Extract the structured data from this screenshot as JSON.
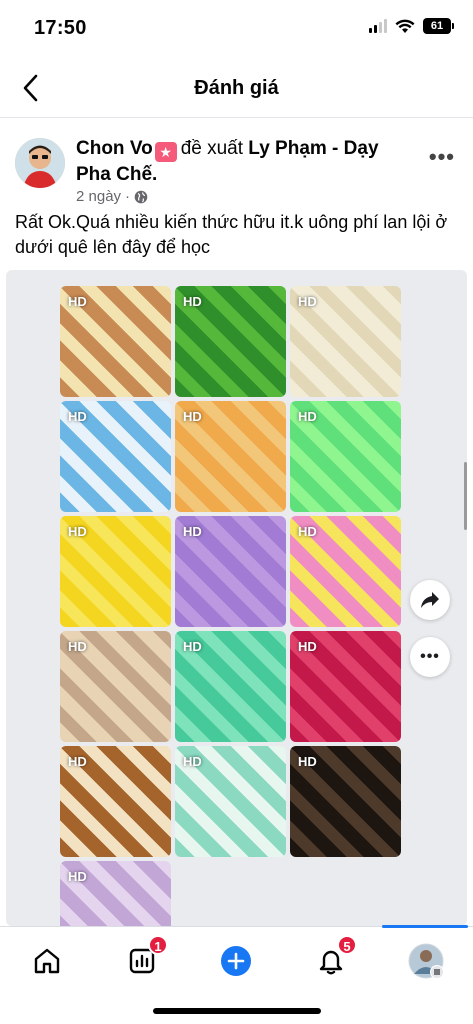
{
  "status_bar": {
    "time": "17:50",
    "battery": "61"
  },
  "nav": {
    "title": "Đánh giá"
  },
  "post": {
    "author": "Chon Vo",
    "verb": "đề xuất",
    "page_name": "Ly Phạm - Dạy Pha Chế.",
    "time": "2 ngày",
    "text": "Rất Ok.Quá nhiều kiến thức hữu it.k uông phí lan lội ở dưới quê lên đây để học"
  },
  "gallery": {
    "hd_label": "HD",
    "tiles": [
      {
        "name": "assorted-jelly-tray",
        "colors": [
          "#c98b54",
          "#f2e3b0",
          "#7ec8e3",
          "#9bd96a"
        ]
      },
      {
        "name": "green-jelly-cubes",
        "colors": [
          "#2f8f2a",
          "#56b83b"
        ]
      },
      {
        "name": "white-jelly-cubes",
        "colors": [
          "#f2ecd6",
          "#e2d8b8"
        ]
      },
      {
        "name": "blue-paw-jellies",
        "colors": [
          "#6bb6e4",
          "#e8f2fa"
        ]
      },
      {
        "name": "orange-jelly-cake",
        "colors": [
          "#f0a94b",
          "#f3c77a"
        ]
      },
      {
        "name": "light-green-jelly",
        "colors": [
          "#5fe07a",
          "#8ef58f"
        ]
      },
      {
        "name": "yellow-jelly-cubes",
        "colors": [
          "#f4d51f",
          "#f8e65a"
        ]
      },
      {
        "name": "purple-jelly-cubes",
        "colors": [
          "#a17bd4",
          "#bb98e0"
        ]
      },
      {
        "name": "pink-layer-jelly",
        "colors": [
          "#f08dc3",
          "#f6e45c"
        ]
      },
      {
        "name": "white-tapioca-pearls",
        "colors": [
          "#e8d3b4",
          "#c4a78a"
        ]
      },
      {
        "name": "green-tapioca-pearls",
        "colors": [
          "#46c99b",
          "#7ee3bb"
        ]
      },
      {
        "name": "red-tapioca-pearls",
        "colors": [
          "#c2184a",
          "#e0406a"
        ]
      },
      {
        "name": "brown-cream-jelly",
        "colors": [
          "#a5642c",
          "#f2e2c2"
        ]
      },
      {
        "name": "mint-paw-jellies",
        "colors": [
          "#8ad9c0",
          "#e7f6ef"
        ]
      },
      {
        "name": "black-tapioca-pearls",
        "colors": [
          "#1c1510",
          "#4d3a2a"
        ]
      },
      {
        "name": "purple-taro-balls",
        "colors": [
          "#c2a6d6",
          "#e4d4ee"
        ]
      }
    ]
  },
  "tabs": {
    "items": [
      {
        "name": "home",
        "badge": ""
      },
      {
        "name": "dashboard",
        "badge": "1"
      },
      {
        "name": "create",
        "badge": ""
      },
      {
        "name": "notifications",
        "badge": "5"
      },
      {
        "name": "profile",
        "badge": ""
      }
    ]
  },
  "colors": {
    "accent": "#1877f2",
    "badge": "#e41e3f",
    "secondary_text": "#65676b"
  }
}
